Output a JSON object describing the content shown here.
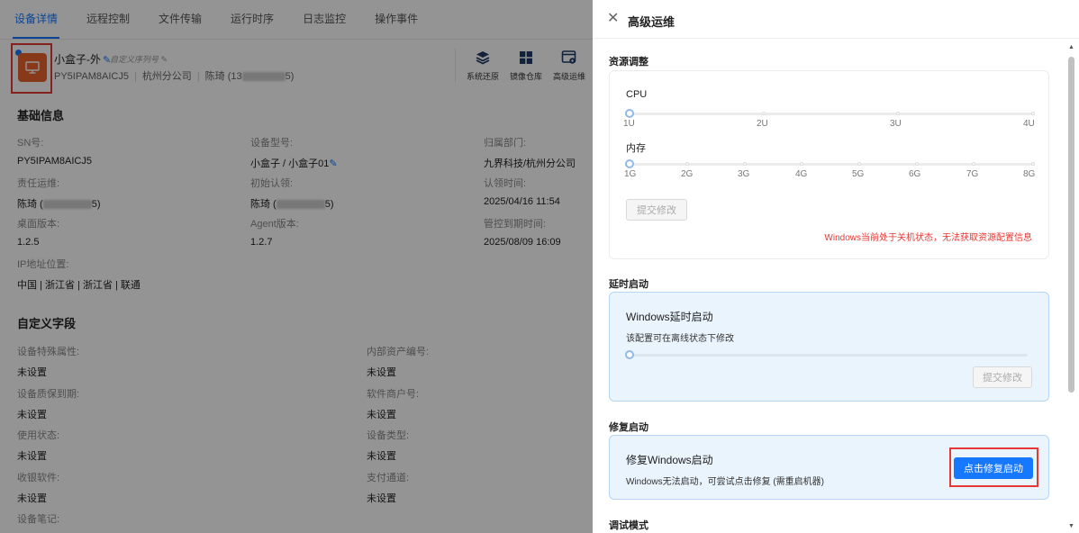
{
  "tabs": [
    {
      "label": "设备详情",
      "active": true
    },
    {
      "label": "远程控制",
      "active": false
    },
    {
      "label": "文件传输",
      "active": false
    },
    {
      "label": "运行时序",
      "active": false
    },
    {
      "label": "日志监控",
      "active": false
    },
    {
      "label": "操作事件",
      "active": false
    }
  ],
  "device": {
    "name": "小盒子-外",
    "custom_seq_placeholder": "自定义序列号",
    "sn": "PY5IPAM8AICJ5",
    "branch": "杭州分公司",
    "owner_prefix": "陈琦 (13",
    "owner_suffix": "5)"
  },
  "toolbar": {
    "system_restore": "系统还原",
    "image_repo": "镜像仓库",
    "advanced_ops": "高级运维"
  },
  "basic_info": {
    "title": "基础信息",
    "fields": [
      {
        "label": "SN号:",
        "value": "PY5IPAM8AICJ5"
      },
      {
        "label": "设备型号:",
        "value": "小盒子  / 小盒子01"
      },
      {
        "label": "归属部门:",
        "value": "九界科技/杭州分公司"
      },
      {
        "label": "责任运维:",
        "value_prefix": "陈琦 (",
        "value_suffix": "5)"
      },
      {
        "label": "初始认领:",
        "value_prefix": "陈琦 (",
        "value_suffix": "5)"
      },
      {
        "label": "认领时间:",
        "value": "2025/04/16 11:54"
      },
      {
        "label": "桌面版本:",
        "value": "1.2.5"
      },
      {
        "label": "Agent版本:",
        "value": "1.2.7"
      },
      {
        "label": "管控到期时间:",
        "value": "2025/08/09 16:09"
      },
      {
        "label": "IP地址位置:",
        "value": "中国 | 浙江省 | 浙江省 | 联通"
      }
    ]
  },
  "custom_fields": {
    "title": "自定义字段",
    "fields": [
      {
        "label": "设备特殊属性:",
        "value": "未设置"
      },
      {
        "label": "内部资产编号:",
        "value": "未设置"
      },
      {
        "label": "设备质保到期:",
        "value": "未设置"
      },
      {
        "label": "软件商户号:",
        "value": "未设置"
      },
      {
        "label": "使用状态:",
        "value": "未设置"
      },
      {
        "label": "设备类型:",
        "value": "未设置"
      },
      {
        "label": "收银软件:",
        "value": "未设置"
      },
      {
        "label": "支付通道:",
        "value": "未设置"
      },
      {
        "label": "设备笔记:",
        "value": ""
      }
    ]
  },
  "drawer": {
    "title": "高级运维",
    "resource": {
      "section_label": "资源调整",
      "cpu_label": "CPU",
      "cpu_ticks": [
        "1U",
        "2U",
        "3U",
        "4U"
      ],
      "cpu_value": "1U",
      "mem_label": "内存",
      "mem_ticks": [
        "1G",
        "2G",
        "3G",
        "4G",
        "5G",
        "6G",
        "7G",
        "8G"
      ],
      "mem_value": "1G",
      "submit_label": "提交修改",
      "warning": "Windows当前处于关机状态，无法获取资源配置信息"
    },
    "delay": {
      "section_label": "延时启动",
      "title": "Windows延时启动",
      "desc": "该配置可在离线状态下修改",
      "submit_label": "提交修改"
    },
    "repair": {
      "section_label": "修复启动",
      "title": "修复Windows启动",
      "desc": "Windows无法启动，可尝试点击修复 (需重启机器)",
      "button_label": "点击修复启动"
    },
    "debug": {
      "section_label": "调试模式"
    }
  },
  "colors": {
    "primary": "#1677ff",
    "danger": "#e53935",
    "device_icon": "#e8632d"
  }
}
